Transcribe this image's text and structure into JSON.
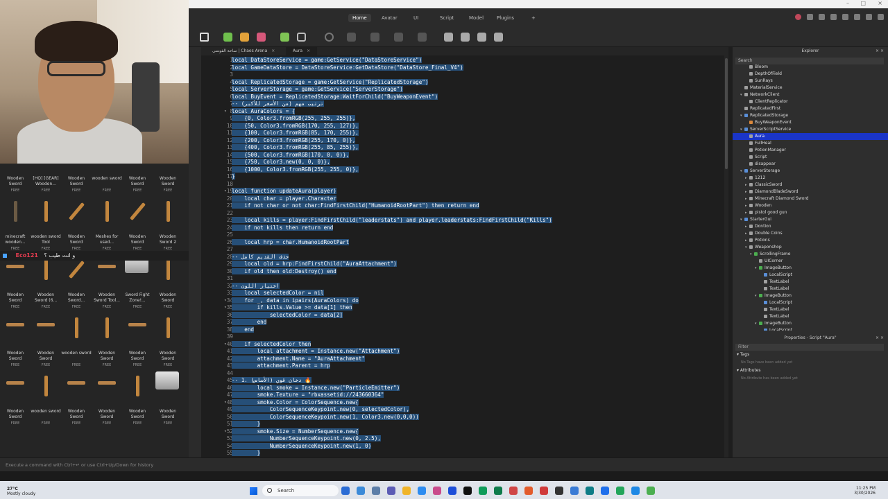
{
  "menubar": {
    "tabs": [
      "Home",
      "Avatar",
      "UI",
      "Script",
      "Model",
      "Plugins"
    ],
    "active": "Home",
    "add_label": "+"
  },
  "editor_tabs": [
    {
      "label": "ساحة الفوضى | Chaos Arena",
      "close": "×",
      "active": false
    },
    {
      "label": "Aura",
      "close": "×",
      "active": true
    }
  ],
  "toolbox": {
    "rows": [
      [
        {
          "name": "Wooden Sword",
          "price": "FREE"
        },
        {
          "name": "[HQ] [GEAR] Wooden...",
          "price": "FREE"
        },
        {
          "name": "Wooden Sword",
          "price": "FREE"
        },
        {
          "name": "wooden sword",
          "price": "FREE"
        },
        {
          "name": "Wooden Sword",
          "price": "FREE"
        },
        {
          "name": "Wooden Sword",
          "price": "FREE"
        }
      ],
      [
        {
          "name": "minecraft wooden...",
          "price": "FREE"
        },
        {
          "name": "wooden sword Tool",
          "price": "FREE"
        },
        {
          "name": "Wooden Sword",
          "price": "FREE"
        },
        {
          "name": "Meshes for used...",
          "price": "FREE"
        },
        {
          "name": "Wooden Sword",
          "price": "FREE"
        },
        {
          "name": "Wooden Sword 2",
          "price": "FREE"
        }
      ],
      [
        {
          "name": "Wooden Sword",
          "price": "FREE"
        },
        {
          "name": "Wooden Sword (6...",
          "price": "FREE"
        },
        {
          "name": "Wooden Sword...",
          "price": "FREE"
        },
        {
          "name": "Wooden Sword Tool...",
          "price": "FREE"
        },
        {
          "name": "Sword Fight Zone!...",
          "price": "FREE"
        },
        {
          "name": "Wooden Sword",
          "price": "FREE"
        }
      ],
      [
        {
          "name": "Wooden Sword",
          "price": "FREE"
        },
        {
          "name": "Wooden Sword",
          "price": "FREE"
        },
        {
          "name": "wooden sword",
          "price": "FREE"
        },
        {
          "name": "Wooden Sword",
          "price": "FREE"
        },
        {
          "name": "Wooden Sword",
          "price": "FREE"
        },
        {
          "name": "Wooden Sword",
          "price": "FREE"
        }
      ],
      [
        {
          "name": "Wooden Sword",
          "price": "FREE"
        },
        {
          "name": "wooden sword",
          "price": "FREE"
        },
        {
          "name": "Wooden Sword",
          "price": "FREE"
        },
        {
          "name": "Wooden Sword",
          "price": "FREE"
        },
        {
          "name": "Wooden Sword",
          "price": "FREE"
        },
        {
          "name": "Wooden Sword",
          "price": "FREE"
        }
      ]
    ],
    "chat": {
      "user": "Eco121",
      "text": "و انت طيب ؟"
    }
  },
  "code": {
    "lines": [
      {
        "n": 1,
        "text": "local DataStoreService = game:GetService(\"DataStoreService\")"
      },
      {
        "n": 2,
        "text": "local GameDataStore = DataStoreService:GetDataStore(\"DataStore_Final_V4\")"
      },
      {
        "n": 3,
        "text": ""
      },
      {
        "n": 4,
        "text": "local ReplicatedStorage = game:GetService(\"ReplicatedStorage\")"
      },
      {
        "n": 5,
        "text": "local ServerStorage = game:GetService(\"ServerStorage\")"
      },
      {
        "n": 6,
        "text": "local BuyEvent = ReplicatedStorage:WaitForChild(\"BuyWeaponEvent\")"
      },
      {
        "n": 7,
        "text": "-- ترتيب مهم (من الأصغر للأكبر)"
      },
      {
        "n": 8,
        "text": "local AuraColors = {"
      },
      {
        "n": 9,
        "text": "    {0, Color3.fromRGB(255, 255, 255)},"
      },
      {
        "n": 10,
        "text": "    {50, Color3.fromRGB(170, 255, 127)},"
      },
      {
        "n": 11,
        "text": "    {100, Color3.fromRGB(85, 170, 255)},"
      },
      {
        "n": 12,
        "text": "    {200, Color3.fromRGB(255, 170, 0)},"
      },
      {
        "n": 13,
        "text": "    {400, Color3.fromRGB(255, 85, 255)},"
      },
      {
        "n": 14,
        "text": "    {500, Color3.fromRGB(170, 0, 0)},"
      },
      {
        "n": 15,
        "text": "    {750, Color3.new(0, 0, 0)},"
      },
      {
        "n": 16,
        "text": "    {1000, Color3.fromRGB(255, 255, 0)},"
      },
      {
        "n": 17,
        "text": "}"
      },
      {
        "n": 18,
        "text": ""
      },
      {
        "n": 19,
        "text": "local function updateAura(player)"
      },
      {
        "n": 20,
        "text": "    local char = player.Character"
      },
      {
        "n": 21,
        "text": "    if not char or not char:FindFirstChild(\"HumanoidRootPart\") then return end"
      },
      {
        "n": 22,
        "text": ""
      },
      {
        "n": 23,
        "text": "    local kills = player:FindFirstChild(\"leaderstats\") and player.leaderstats:FindFirstChild(\"Kills\")"
      },
      {
        "n": 24,
        "text": "    if not kills then return end"
      },
      {
        "n": 25,
        "text": ""
      },
      {
        "n": 26,
        "text": "    local hrp = char.HumanoidRootPart"
      },
      {
        "n": 27,
        "text": ""
      },
      {
        "n": 28,
        "text": "-- حذف القديم كامل"
      },
      {
        "n": 29,
        "text": "    local old = hrp:FindFirstChild(\"AuraAttachment\")"
      },
      {
        "n": 30,
        "text": "    if old then old:Destroy() end"
      },
      {
        "n": 31,
        "text": ""
      },
      {
        "n": 32,
        "text": "-- اختيار اللون"
      },
      {
        "n": 33,
        "text": "    local selectedColor = nil"
      },
      {
        "n": 34,
        "text": "    for _, data in ipairs(AuraColors) do"
      },
      {
        "n": 35,
        "text": "        if kills.Value >= data[1] then"
      },
      {
        "n": 36,
        "text": "            selectedColor = data[2]"
      },
      {
        "n": 37,
        "text": "        end"
      },
      {
        "n": 38,
        "text": "    end"
      },
      {
        "n": 39,
        "text": ""
      },
      {
        "n": 40,
        "text": "    if selectedColor then"
      },
      {
        "n": 41,
        "text": "        local attachment = Instance.new(\"Attachment\")"
      },
      {
        "n": 42,
        "text": "        attachment.Name = \"AuraAttachment\""
      },
      {
        "n": 43,
        "text": "        attachment.Parent = hrp"
      },
      {
        "n": 44,
        "text": ""
      },
      {
        "n": 45,
        "text": "-- 1. دخان قوي (الأساس) 🔥"
      },
      {
        "n": 46,
        "text": "        local smoke = Instance.new(\"ParticleEmitter\")"
      },
      {
        "n": 47,
        "text": "        smoke.Texture = \"rbxassetid://243660364\""
      },
      {
        "n": 48,
        "text": "        smoke.Color = ColorSequence.new{"
      },
      {
        "n": 49,
        "text": "            ColorSequenceKeypoint.new(0, selectedColor),"
      },
      {
        "n": 50,
        "text": "            ColorSequenceKeypoint.new(1, Color3.new(0,0,0))"
      },
      {
        "n": 51,
        "text": "        }"
      },
      {
        "n": 52,
        "text": "        smoke.Size = NumberSequence.new{"
      },
      {
        "n": 53,
        "text": "            NumberSequenceKeypoint.new(0, 2.5),"
      },
      {
        "n": 54,
        "text": "            NumberSequenceKeypoint.new(1, 0)"
      },
      {
        "n": 55,
        "text": "        }"
      }
    ],
    "fold_lines": [
      8,
      19,
      34,
      35,
      40,
      48,
      52
    ]
  },
  "explorer": {
    "title": "Explorer",
    "search_placeholder": "Search",
    "items": [
      {
        "label": "Bloom",
        "indent": 2,
        "icon": "grey"
      },
      {
        "label": "DepthOfField",
        "indent": 2,
        "icon": "grey"
      },
      {
        "label": "SunRays",
        "indent": 2,
        "icon": "grey"
      },
      {
        "label": "MaterialService",
        "indent": 1,
        "icon": "grey"
      },
      {
        "label": "NetworkClient",
        "indent": 1,
        "icon": "grey",
        "arrow": "▾"
      },
      {
        "label": "ClientReplicator",
        "indent": 2,
        "icon": "grey"
      },
      {
        "label": "ReplicatedFirst",
        "indent": 1,
        "icon": "grey"
      },
      {
        "label": "ReplicatedStorage",
        "indent": 1,
        "icon": "blue",
        "arrow": "▾"
      },
      {
        "label": "BuyWeaponEvent",
        "indent": 2,
        "icon": "orange"
      },
      {
        "label": "ServerScriptService",
        "indent": 1,
        "icon": "blue",
        "arrow": "▾"
      },
      {
        "label": "Aura",
        "indent": 2,
        "icon": "grey",
        "selected": true
      },
      {
        "label": "FullHeal",
        "indent": 2,
        "icon": "grey"
      },
      {
        "label": "PotionManager",
        "indent": 2,
        "icon": "grey"
      },
      {
        "label": "Script",
        "indent": 2,
        "icon": "grey"
      },
      {
        "label": "disappear",
        "indent": 2,
        "icon": "grey"
      },
      {
        "label": "ServerStorage",
        "indent": 1,
        "icon": "blue",
        "arrow": "▾"
      },
      {
        "label": "1212",
        "indent": 2,
        "icon": "grey",
        "arrow": "▸"
      },
      {
        "label": "ClassicSword",
        "indent": 2,
        "icon": "grey",
        "arrow": "▸"
      },
      {
        "label": "DiamondBladeSword",
        "indent": 2,
        "icon": "grey",
        "arrow": "▸"
      },
      {
        "label": "Minecraft Diamond Sword",
        "indent": 2,
        "icon": "grey",
        "arrow": "▸"
      },
      {
        "label": "Wooden",
        "indent": 2,
        "icon": "grey",
        "arrow": "▸"
      },
      {
        "label": "pistol good gun",
        "indent": 2,
        "icon": "grey",
        "arrow": "▸"
      },
      {
        "label": "StarterGui",
        "indent": 1,
        "icon": "blue",
        "arrow": "▾"
      },
      {
        "label": "Dontion",
        "indent": 2,
        "icon": "grey",
        "arrow": "▸"
      },
      {
        "label": "Double Coins",
        "indent": 2,
        "icon": "grey",
        "arrow": "▸"
      },
      {
        "label": "Potions",
        "indent": 2,
        "icon": "grey",
        "arrow": "▸"
      },
      {
        "label": "Weaponshop",
        "indent": 2,
        "icon": "grey",
        "arrow": "▾"
      },
      {
        "label": "ScrollingFrame",
        "indent": 3,
        "icon": "green",
        "arrow": "▾"
      },
      {
        "label": "UICorner",
        "indent": 4,
        "icon": "grey"
      },
      {
        "label": "ImageButton",
        "indent": 4,
        "icon": "green",
        "arrow": "▾"
      },
      {
        "label": "LocalScript",
        "indent": 5,
        "icon": "blue"
      },
      {
        "label": "TextLabel",
        "indent": 5,
        "icon": "grey"
      },
      {
        "label": "TextLabel",
        "indent": 5,
        "icon": "grey"
      },
      {
        "label": "ImageButton",
        "indent": 4,
        "icon": "green",
        "arrow": "▾"
      },
      {
        "label": "LocalScript",
        "indent": 5,
        "icon": "blue"
      },
      {
        "label": "TextLabel",
        "indent": 5,
        "icon": "grey"
      },
      {
        "label": "TextLabel",
        "indent": 5,
        "icon": "grey"
      },
      {
        "label": "ImageButton",
        "indent": 4,
        "icon": "green",
        "arrow": "▾"
      },
      {
        "label": "LocalScript",
        "indent": 5,
        "icon": "blue"
      }
    ]
  },
  "properties": {
    "title": "Properties - Script \"Aura\"",
    "filter_placeholder": "Filter",
    "sections": [
      {
        "label": "Tags",
        "note": "No Tags have been added yet"
      },
      {
        "label": "Attributes",
        "note": "No Attribute has been added yet"
      }
    ]
  },
  "command_bar": {
    "placeholder": "Execute a command with Ctrl+↵ or use Ctrl+Up/Down for history"
  },
  "taskbar": {
    "weather_temp": "27°C",
    "weather_desc": "Mostly cloudy",
    "search_label": "Search",
    "time": "11:25 PM",
    "date": "3/30/2026"
  },
  "colors": {
    "selection": "#264f78",
    "explorer_selected": "#1a35c8",
    "editor_bg": "#1e1e1e",
    "panel_bg": "#2e2e2e"
  }
}
